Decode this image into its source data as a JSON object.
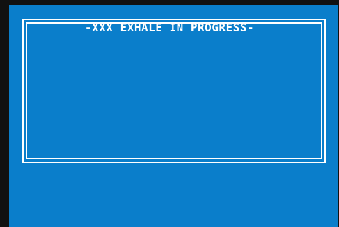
{
  "panel": {
    "title": "-XXX EXHALE IN PROGRESS-"
  },
  "colors": {
    "background": "#0a7ecb",
    "frame": "#ffffff",
    "bezel": "#111111"
  }
}
